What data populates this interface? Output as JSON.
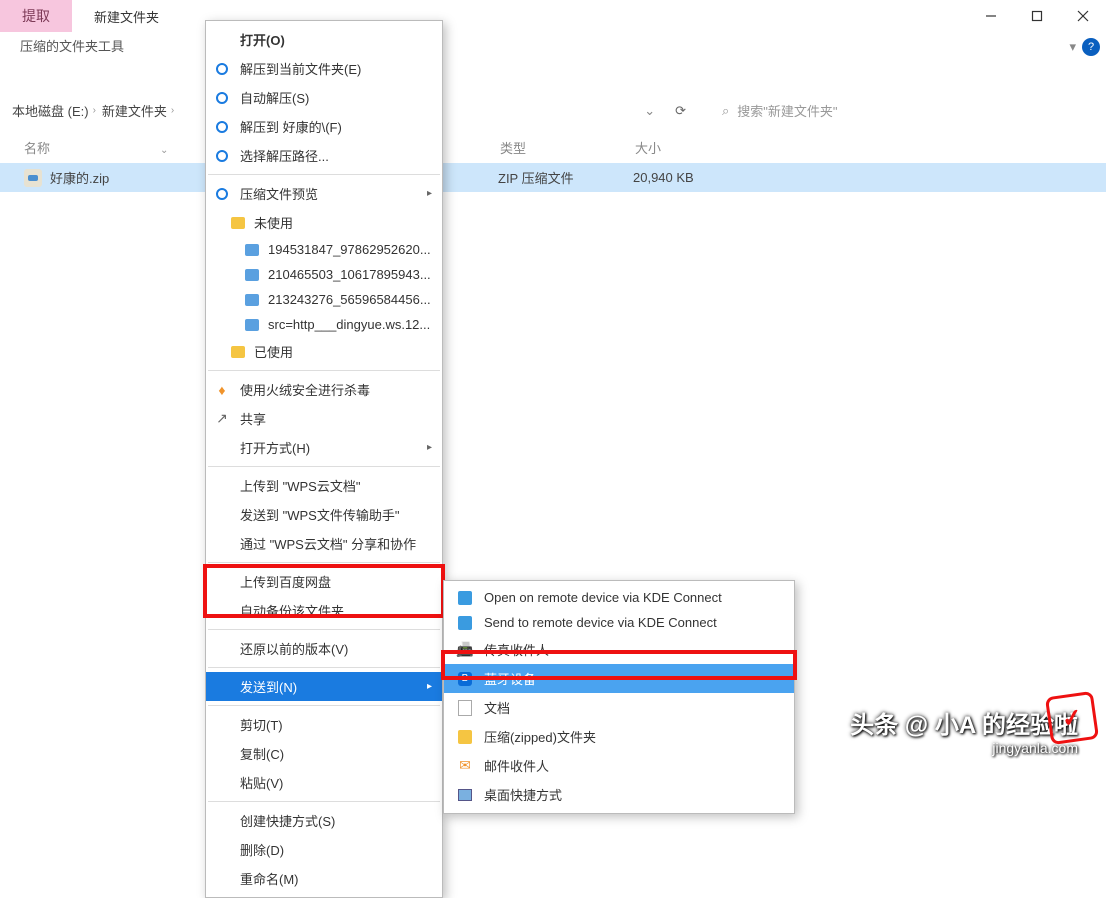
{
  "window": {
    "extract_btn": "提取",
    "title": "新建文件夹",
    "ribbon_label": "压缩的文件夹工具"
  },
  "path": {
    "seg1": "本地磁盘 (E:)",
    "seg2": "新建文件夹",
    "search_placeholder": "搜索\"新建文件夹\""
  },
  "columns": {
    "name": "名称",
    "type": "类型",
    "size": "大小"
  },
  "file": {
    "name": "好康的.zip",
    "type": "ZIP 压缩文件",
    "size": "20,940 KB"
  },
  "menu1": {
    "open": "打开(O)",
    "extract_current": "解压到当前文件夹(E)",
    "auto_extract": "自动解压(S)",
    "extract_to": "解压到 好康的\\(F)",
    "select_path": "选择解压路径...",
    "zip_preview": "压缩文件预览",
    "unused": "未使用",
    "f1": "194531847_97862952620...",
    "f2": "210465503_10617895943...",
    "f3": "213243276_56596584456...",
    "f4": "src=http___dingyue.ws.12...",
    "used": "已使用",
    "scan": "使用火绒安全进行杀毒",
    "share": "共享",
    "open_with": "打开方式(H)",
    "wps1": "上传到 \"WPS云文档\"",
    "wps2": "发送到 \"WPS文件传输助手\"",
    "wps3": "通过 \"WPS云文档\" 分享和协作",
    "baidu1": "上传到百度网盘",
    "baidu2": "自动备份该文件夹",
    "restore": "还原以前的版本(V)",
    "send_to": "发送到(N)",
    "cut": "剪切(T)",
    "copy": "复制(C)",
    "paste": "粘贴(V)",
    "shortcut": "创建快捷方式(S)",
    "delete": "删除(D)",
    "rename": "重命名(M)"
  },
  "menu2": {
    "kde1": "Open on remote device via KDE Connect",
    "kde2": "Send to remote device via KDE Connect",
    "fax": "传真收件人",
    "bluetooth": "蓝牙设备",
    "doc": "文档",
    "zip": "压缩(zipped)文件夹",
    "mail": "邮件收件人",
    "desk": "桌面快捷方式"
  },
  "watermark": {
    "line1": "头条 @ 小A 的经验啦",
    "line2": "jingyanla.com"
  }
}
